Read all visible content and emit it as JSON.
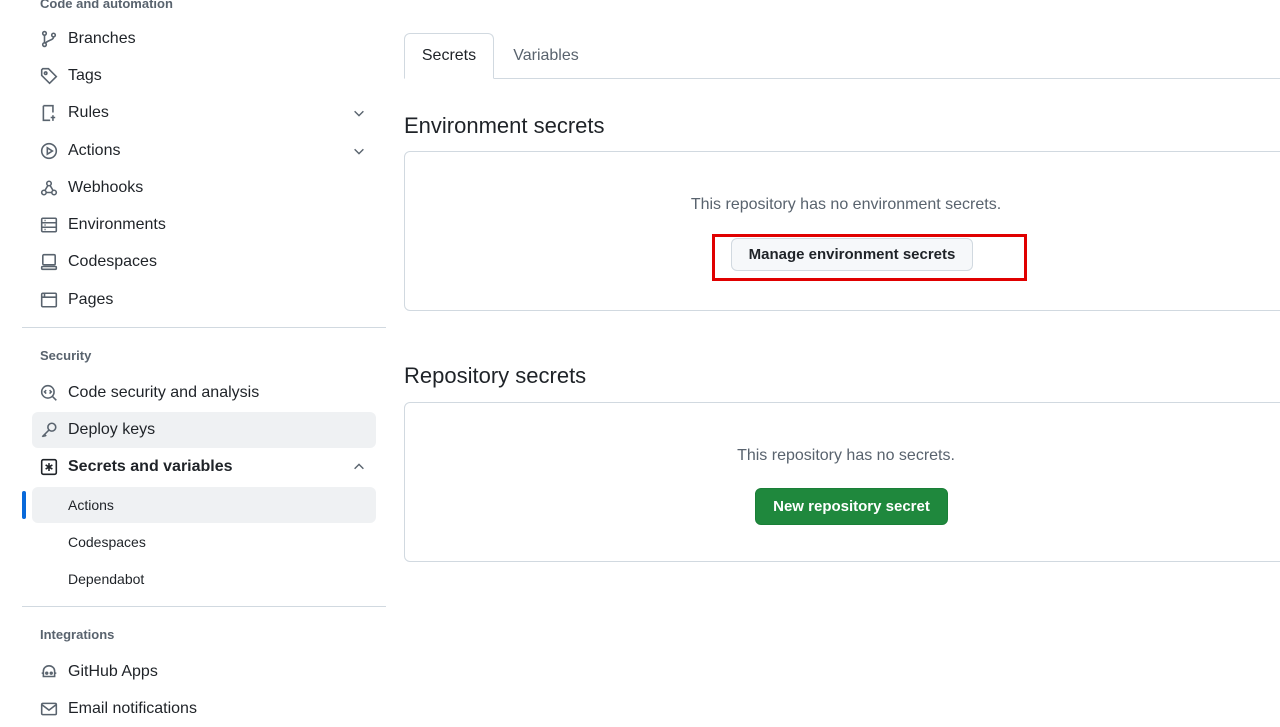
{
  "sidebar": {
    "code_heading": "Code and automation",
    "code_items": [
      {
        "label": "Branches",
        "icon": "branch-icon"
      },
      {
        "label": "Tags",
        "icon": "tag-icon"
      },
      {
        "label": "Rules",
        "icon": "rules-icon"
      },
      {
        "label": "Actions",
        "icon": "play-icon"
      },
      {
        "label": "Webhooks",
        "icon": "webhook-icon"
      },
      {
        "label": "Environments",
        "icon": "server-icon"
      },
      {
        "label": "Codespaces",
        "icon": "codespaces-icon"
      },
      {
        "label": "Pages",
        "icon": "browser-icon"
      }
    ],
    "security_heading": "Security",
    "security_items": [
      {
        "label": "Code security and analysis",
        "icon": "codescan-icon"
      },
      {
        "label": "Deploy keys",
        "icon": "key-icon"
      },
      {
        "label": "Secrets and variables",
        "icon": "asterisk-icon"
      }
    ],
    "secrets_subitems": [
      {
        "label": "Actions"
      },
      {
        "label": "Codespaces"
      },
      {
        "label": "Dependabot"
      }
    ],
    "integrations_heading": "Integrations",
    "integrations_items": [
      {
        "label": "GitHub Apps",
        "icon": "apps-icon"
      },
      {
        "label": "Email notifications",
        "icon": "mail-icon"
      }
    ]
  },
  "tabs": [
    {
      "label": "Secrets"
    },
    {
      "label": "Variables"
    }
  ],
  "environment_section": {
    "title": "Environment secrets",
    "empty_text": "This repository has no environment secrets.",
    "button_label": "Manage environment secrets"
  },
  "repository_section": {
    "title": "Repository secrets",
    "empty_text": "This repository has no secrets.",
    "button_label": "New repository secret"
  },
  "colors": {
    "accent_blue": "#0969da",
    "primary_green": "#1f883d",
    "highlight_red": "#e00000"
  }
}
